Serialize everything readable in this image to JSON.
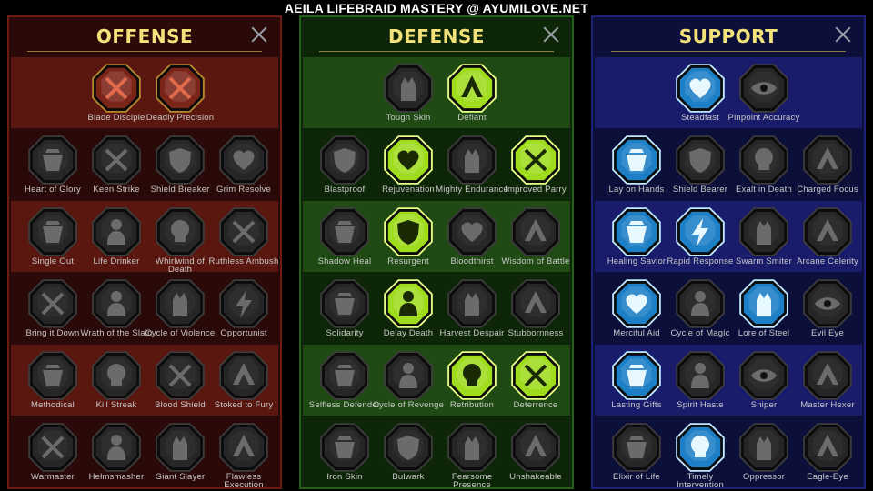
{
  "page_title": "AEILA LIFEBRAID MASTERY @ AYUMILOVE.NET",
  "colors": {
    "offense_frame": "#6d1a13",
    "defense_frame": "#275f1a",
    "support_frame": "#1e237a",
    "title_gold": "#f3e27a",
    "inactive_icon": "#2b2b2b",
    "defense_active": "#a6e22a",
    "support_active": "#2b9bd8",
    "offense_active": "#8a2a1e"
  },
  "trees": [
    {
      "key": "offense",
      "title": "OFFENSE",
      "rows": [
        [
          {
            "label": "Blade Disciple",
            "icon": "crossed-swords-icon",
            "active": true
          },
          {
            "label": "Deadly Precision",
            "icon": "daggers-icon",
            "active": true
          }
        ],
        [
          {
            "label": "Heart of Glory",
            "icon": "horned-helmet-icon",
            "active": false
          },
          {
            "label": "Keen Strike",
            "icon": "slash-icon",
            "active": false
          },
          {
            "label": "Shield Breaker",
            "icon": "shield-arrow-icon",
            "active": false
          },
          {
            "label": "Grim Resolve",
            "icon": "broken-heart-icon",
            "active": false
          }
        ],
        [
          {
            "label": "Single Out",
            "icon": "target-figure-icon",
            "active": false
          },
          {
            "label": "Life Drinker",
            "icon": "fangs-icon",
            "active": false
          },
          {
            "label": "Whirlwind of Death",
            "icon": "skull-cape-icon",
            "active": false
          },
          {
            "label": "Ruthless Ambush",
            "icon": "fist-blade-icon",
            "active": false
          }
        ],
        [
          {
            "label": "Bring it Down",
            "icon": "falling-sword-icon",
            "active": false
          },
          {
            "label": "Wrath of the Slain",
            "icon": "hammer-fist-icon",
            "active": false
          },
          {
            "label": "Cycle of Violence",
            "icon": "axes-icon",
            "active": false
          },
          {
            "label": "Opportunist",
            "icon": "chain-lightning-icon",
            "active": false
          }
        ],
        [
          {
            "label": "Methodical",
            "icon": "spider-legs-icon",
            "active": false
          },
          {
            "label": "Kill Streak",
            "icon": "skull-icon",
            "active": false
          },
          {
            "label": "Blood Shield",
            "icon": "sword-shield-icon",
            "active": false
          },
          {
            "label": "Stoked to Fury",
            "icon": "raging-figure-icon",
            "active": false
          }
        ],
        [
          {
            "label": "Warmaster",
            "icon": "sword-strike-icon",
            "active": false
          },
          {
            "label": "Helmsmasher",
            "icon": "knight-helmet-icon",
            "active": false
          },
          {
            "label": "Giant Slayer",
            "icon": "giant-icon",
            "active": false
          },
          {
            "label": "Flawless Execution",
            "icon": "executioner-icon",
            "active": false
          }
        ]
      ]
    },
    {
      "key": "defense",
      "title": "DEFENSE",
      "rows": [
        [
          {
            "label": "Tough Skin",
            "icon": "armor-plates-icon",
            "active": false
          },
          {
            "label": "Defiant",
            "icon": "raised-fist-icon",
            "active": true
          }
        ],
        [
          {
            "label": "Blastproof",
            "icon": "chevron-shield-icon",
            "active": false
          },
          {
            "label": "Rejuvenation",
            "icon": "heart-hand-icon",
            "active": true
          },
          {
            "label": "Mighty Endurance",
            "icon": "muscle-torso-icon",
            "active": false
          },
          {
            "label": "Improved Parry",
            "icon": "crossed-blades-icon",
            "active": true
          }
        ],
        [
          {
            "label": "Shadow Heal",
            "icon": "shadow-figure-icon",
            "active": false
          },
          {
            "label": "Resurgent",
            "icon": "knight-shield-icon",
            "active": true
          },
          {
            "label": "Bloodthirst",
            "icon": "skull-heart-icon",
            "active": false
          },
          {
            "label": "Wisdom of Battle",
            "icon": "hooded-face-icon",
            "active": false
          }
        ],
        [
          {
            "label": "Solidarity",
            "icon": "crowd-icon",
            "active": false
          },
          {
            "label": "Delay Death",
            "icon": "hourglass-icon",
            "active": true
          },
          {
            "label": "Harvest Despair",
            "icon": "open-hand-icon",
            "active": false
          },
          {
            "label": "Stubbornness",
            "icon": "bull-icon",
            "active": false
          }
        ],
        [
          {
            "label": "Selfless Defender",
            "icon": "runner-icon",
            "active": false
          },
          {
            "label": "Cycle of Revenge",
            "icon": "drops-icon",
            "active": false
          },
          {
            "label": "Retribution",
            "icon": "burning-skull-icon",
            "active": true
          },
          {
            "label": "Deterrence",
            "icon": "slashing-hand-icon",
            "active": true
          }
        ],
        [
          {
            "label": "Iron Skin",
            "icon": "iron-figure-icon",
            "active": false
          },
          {
            "label": "Bulwark",
            "icon": "round-shield-icon",
            "active": false
          },
          {
            "label": "Fearsome Presence",
            "icon": "demon-face-icon",
            "active": false
          },
          {
            "label": "Unshakeable",
            "icon": "stone-giant-icon",
            "active": false
          }
        ]
      ]
    },
    {
      "key": "support",
      "title": "SUPPORT",
      "rows": [
        [
          {
            "label": "Steadfast",
            "icon": "hands-heart-icon",
            "active": true
          },
          {
            "label": "Pinpoint Accuracy",
            "icon": "bullseye-icon",
            "active": false
          }
        ],
        [
          {
            "label": "Lay on Hands",
            "icon": "praying-hands-icon",
            "active": true
          },
          {
            "label": "Shield Bearer",
            "icon": "shield-ring-icon",
            "active": false
          },
          {
            "label": "Exalt in Death",
            "icon": "skull-smoke-icon",
            "active": false
          },
          {
            "label": "Charged Focus",
            "icon": "arrow-stream-icon",
            "active": false
          }
        ],
        [
          {
            "label": "Healing Savior",
            "icon": "healer-figure-icon",
            "active": true
          },
          {
            "label": "Rapid Response",
            "icon": "lightning-icon",
            "active": true
          },
          {
            "label": "Swarm Smiter",
            "icon": "swarm-icon",
            "active": false
          },
          {
            "label": "Arcane Celerity",
            "icon": "twin-figures-icon",
            "active": false
          }
        ],
        [
          {
            "label": "Merciful Aid",
            "icon": "chained-heart-icon",
            "active": true
          },
          {
            "label": "Cycle of Magic",
            "icon": "comet-icon",
            "active": false
          },
          {
            "label": "Lore of Steel",
            "icon": "open-book-icon",
            "active": true
          },
          {
            "label": "Evil Eye",
            "icon": "eye-rays-icon",
            "active": false
          }
        ],
        [
          {
            "label": "Lasting Gifts",
            "icon": "compass-star-icon",
            "active": true
          },
          {
            "label": "Spirit Haste",
            "icon": "winged-boot-icon",
            "active": false
          },
          {
            "label": "Sniper",
            "icon": "eye-icon",
            "active": false
          },
          {
            "label": "Master Hexer",
            "icon": "hex-rune-icon",
            "active": false
          }
        ],
        [
          {
            "label": "Elixir of Life",
            "icon": "potion-icon",
            "active": false
          },
          {
            "label": "Timely Intervention",
            "icon": "demon-skull-icon",
            "active": true
          },
          {
            "label": "Oppressor",
            "icon": "gauntlet-icon",
            "active": false
          },
          {
            "label": "Eagle-Eye",
            "icon": "eagle-icon",
            "active": false
          }
        ]
      ]
    }
  ]
}
